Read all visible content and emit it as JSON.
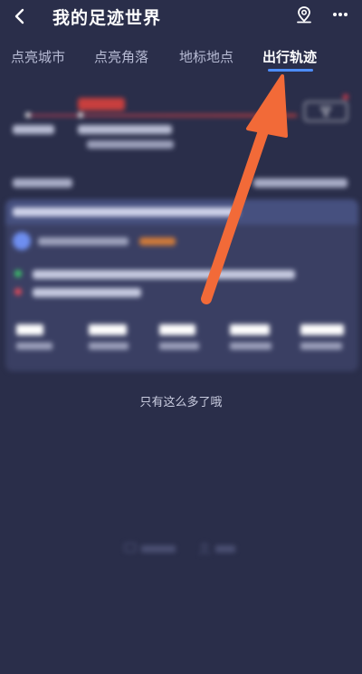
{
  "header": {
    "title": "我的足迹世界",
    "back_icon": "chevron-left-icon",
    "pin_icon": "map-pin-icon",
    "more_icon": "more-horizontal-icon"
  },
  "tabs": [
    {
      "label": "点亮城市",
      "active": false
    },
    {
      "label": "点亮角落",
      "active": false
    },
    {
      "label": "地标地点",
      "active": false
    },
    {
      "label": "出行轨迹",
      "active": true
    }
  ],
  "footer_note": "只有这么多了哦",
  "colors": {
    "background": "#2a2e4a",
    "active_tab_underline": "#4d8dff",
    "annotation_arrow": "#f26a38",
    "route_line": "#c8403e"
  },
  "annotation": {
    "type": "arrow",
    "points_to": "tab-出行轨迹"
  }
}
